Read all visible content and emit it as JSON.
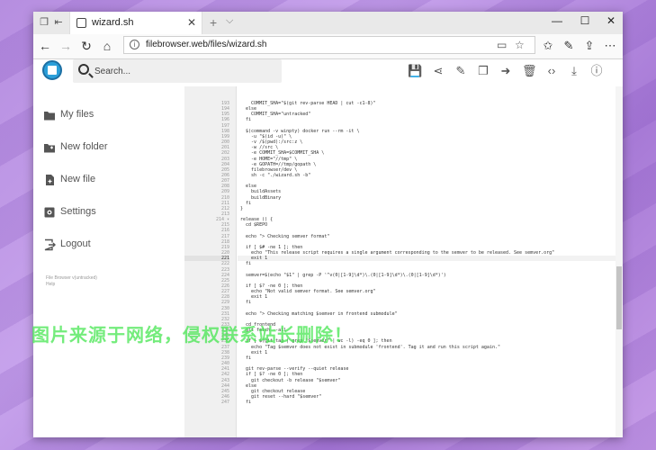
{
  "browser": {
    "tab_title": "wizard.sh",
    "tab_close": "✕",
    "new_tab": "+",
    "tab_menu": "⌵",
    "url": "filebrowser.web/files/wizard.sh"
  },
  "app": {
    "search_placeholder": "Search..."
  },
  "sidebar": {
    "items": [
      {
        "label": "My files",
        "icon": "folder-icon"
      },
      {
        "label": "New folder",
        "icon": "create-new-folder-icon"
      },
      {
        "label": "New file",
        "icon": "note-add-icon"
      },
      {
        "label": "Settings",
        "icon": "settings-icon"
      },
      {
        "label": "Logout",
        "icon": "exit-icon"
      }
    ],
    "footer_line1": "File Browser v(untracked)",
    "footer_line2": "Help"
  },
  "editor": {
    "active_line": 221,
    "lines": [
      {
        "n": "193",
        "t": "    COMMIT_SHA=\"$(git rev-parse HEAD | cut -c1-8)\""
      },
      {
        "n": "194",
        "t": "  else"
      },
      {
        "n": "195",
        "t": "    COMMIT_SHA=\"untracked\""
      },
      {
        "n": "196",
        "t": "  fi"
      },
      {
        "n": "197",
        "t": ""
      },
      {
        "n": "198",
        "t": "  $(command -v winpty) docker run --rm -it \\"
      },
      {
        "n": "199",
        "t": "    -u \"$(id -u)\" \\"
      },
      {
        "n": "200",
        "t": "    -v /$(pwd):/src:z \\"
      },
      {
        "n": "201",
        "t": "    -w //src \\"
      },
      {
        "n": "202",
        "t": "    -e COMMIT_SHA=$COMMIT_SHA \\"
      },
      {
        "n": "203",
        "t": "    -e HOME=\"//tmp\" \\"
      },
      {
        "n": "204",
        "t": "    -e GOPATH=//tmp/gopath \\"
      },
      {
        "n": "205",
        "t": "    filebrowser/dev \\"
      },
      {
        "n": "206",
        "t": "    sh -c \"./wizard.sh -b\""
      },
      {
        "n": "207",
        "t": ""
      },
      {
        "n": "208",
        "t": "  else"
      },
      {
        "n": "209",
        "t": "    buildAssets"
      },
      {
        "n": "210",
        "t": "    buildBinary"
      },
      {
        "n": "211",
        "t": "  fi"
      },
      {
        "n": "212",
        "t": "}"
      },
      {
        "n": "213",
        "t": ""
      },
      {
        "n": "214 ▾",
        "t": "release () {"
      },
      {
        "n": "215",
        "t": "  cd $REPO"
      },
      {
        "n": "216",
        "t": ""
      },
      {
        "n": "217",
        "t": "  echo \"> Checking semver format\""
      },
      {
        "n": "218",
        "t": ""
      },
      {
        "n": "219",
        "t": "  if [ $# -ne 1 ]; then"
      },
      {
        "n": "220",
        "t": "    echo \"This release script requires a single argument corresponding to the semver to be released. See semver.org\""
      },
      {
        "n": "221",
        "t": "    exit 1"
      },
      {
        "n": "222",
        "t": "  fi"
      },
      {
        "n": "223",
        "t": ""
      },
      {
        "n": "224",
        "t": "  semver=$(echo \"$1\" | grep -P '^v(0|[1-9]\\d*)\\.(0|[1-9]\\d*)\\.(0|[1-9]\\d*)')"
      },
      {
        "n": "225",
        "t": ""
      },
      {
        "n": "226",
        "t": "  if [ $? -ne 0 ]; then"
      },
      {
        "n": "227",
        "t": "    echo \"Not valid semver format. See semver.org\""
      },
      {
        "n": "228",
        "t": "    exit 1"
      },
      {
        "n": "229",
        "t": "  fi"
      },
      {
        "n": "230",
        "t": ""
      },
      {
        "n": "231",
        "t": "  echo \"> Checking matching $semver in frontend submodule\""
      },
      {
        "n": "232",
        "t": ""
      },
      {
        "n": "233",
        "t": "  cd frontend"
      },
      {
        "n": "234",
        "t": "  git fetch --all"
      },
      {
        "n": "235",
        "t": ""
      },
      {
        "n": "236",
        "t": "  if [ $(git tag | grep \"$semver\" | wc -l) -eq 0 ]; then"
      },
      {
        "n": "237",
        "t": "    echo \"Tag $semver does not exist in submodule 'frontend'. Tag it and run this script again.\""
      },
      {
        "n": "238",
        "t": "    exit 1"
      },
      {
        "n": "239",
        "t": "  fi"
      },
      {
        "n": "240",
        "t": ""
      },
      {
        "n": "241",
        "t": "  git rev-parse --verify --quiet release"
      },
      {
        "n": "242",
        "t": "  if [ $? -ne 0 ]; then"
      },
      {
        "n": "243",
        "t": "    git checkout -b release \"$semver\""
      },
      {
        "n": "244",
        "t": "  else"
      },
      {
        "n": "245",
        "t": "    git checkout release"
      },
      {
        "n": "246",
        "t": "    git reset --hard \"$semver\""
      },
      {
        "n": "247",
        "t": "  fi"
      }
    ]
  },
  "watermark": "图片来源于网络，侵权联系站长删除！"
}
